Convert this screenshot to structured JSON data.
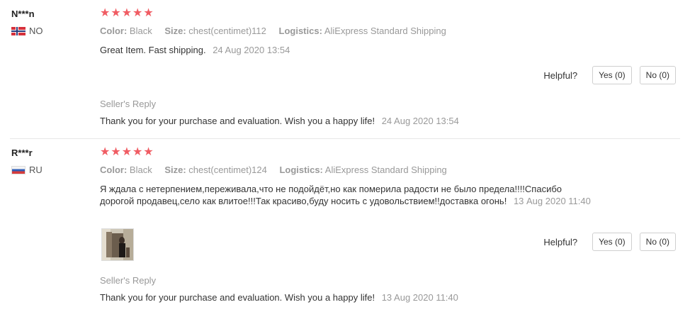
{
  "reviews": [
    {
      "user": "N***n",
      "country": "NO",
      "stars": "★★★★★",
      "color_label": "Color:",
      "color_value": "Black",
      "size_label": "Size:",
      "size_value": "chest(centimet)112",
      "logistics_label": "Logistics:",
      "logistics_value": "AliExpress Standard Shipping",
      "feedback": "Great Item. Fast shipping.",
      "time": "24 Aug 2020 13:54",
      "helpful_label": "Helpful?",
      "yes_label": "Yes (0)",
      "no_label": "No (0)",
      "reply_title": "Seller's Reply",
      "reply_text": "Thank you for your purchase and evaluation. Wish you a happy life!",
      "reply_time": "24 Aug 2020 13:54"
    },
    {
      "user": "R***r",
      "country": "RU",
      "stars": "★★★★★",
      "color_label": "Color:",
      "color_value": "Black",
      "size_label": "Size:",
      "size_value": "chest(centimet)124",
      "logistics_label": "Logistics:",
      "logistics_value": "AliExpress Standard Shipping",
      "feedback": "Я ждала с нетерпением,переживала,что не подойдёт,но как померила радости не было предела!!!!Спасибо дорогой продавец,село как влитое!!!Так красиво,буду носить с удовольствием!!доставка огонь!",
      "time": "13 Aug 2020 11:40",
      "helpful_label": "Helpful?",
      "yes_label": "Yes (0)",
      "no_label": "No (0)",
      "reply_title": "Seller's Reply",
      "reply_text": "Thank you for your purchase and evaluation. Wish you a happy life!",
      "reply_time": "13 Aug 2020 11:40"
    }
  ],
  "colors": {
    "star": "#f05c63",
    "muted": "#999999",
    "text": "#333333"
  }
}
